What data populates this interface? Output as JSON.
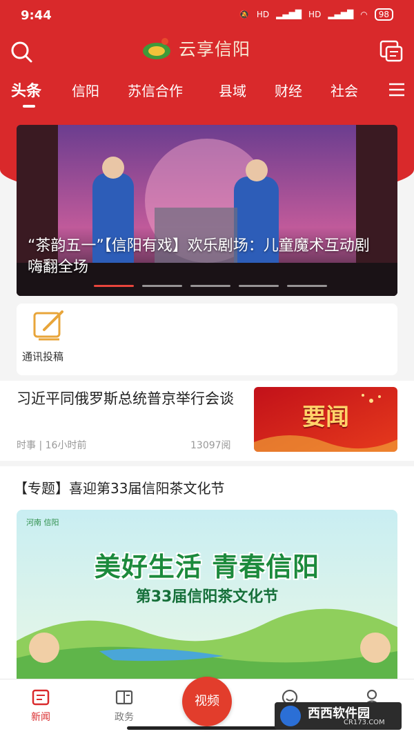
{
  "status": {
    "time": "9:44",
    "signal_labels": [
      "HD",
      "HD"
    ],
    "battery": "98"
  },
  "header": {
    "app_name": "云享信阳"
  },
  "tabs": [
    "头条",
    "信阳",
    "苏信合作",
    "县域",
    "财经",
    "社会"
  ],
  "banner": {
    "title": "“茶韵五一”【信阳有戏】欢乐剧场：儿童魔术互动剧嗨翻全场",
    "dot_count": 5,
    "active_dot": 1
  },
  "tools": [
    {
      "label": "通讯投稿",
      "icon": "edit-icon"
    }
  ],
  "news": [
    {
      "title": "习近平同俄罗斯总统普京举行会谈",
      "category": "时事",
      "time": "16小时前",
      "reads": "13097阅",
      "thumb_text": "要闻"
    }
  ],
  "topic": {
    "title": "【专题】喜迎第33届信阳茶文化节",
    "banner_headline": "美好生活 青春信阳",
    "banner_subtitle": "第33届信阳茶文化节",
    "banner_logo": "河南 信阳"
  },
  "tabbar": [
    {
      "label": "新闻",
      "icon": "news-icon",
      "active": true
    },
    {
      "label": "政务",
      "icon": "government-icon",
      "active": false
    },
    {
      "label": "视频",
      "icon": "video-icon",
      "active": false
    },
    {
      "label": "",
      "icon": "smile-icon",
      "active": false
    },
    {
      "label": "",
      "icon": "user-icon",
      "active": false
    }
  ],
  "watermark": {
    "name": "西西软件园",
    "url": "CR173.COM"
  },
  "colors": {
    "brand_red": "#d9292b",
    "tab_active_red": "#d9292b",
    "topic_green": "#1c8a3c"
  }
}
